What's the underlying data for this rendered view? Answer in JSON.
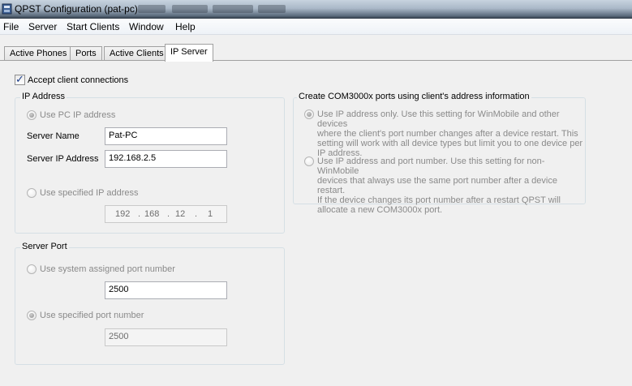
{
  "window": {
    "title": "QPST Configuration (pat-pc)"
  },
  "menu": [
    "File",
    "Server",
    "Start Clients",
    "Window",
    "Help"
  ],
  "tabs": [
    "Active Phones",
    "Ports",
    "Active Clients",
    "IP Server"
  ],
  "accept_connections": {
    "label": "Accept client connections",
    "checked": true
  },
  "ip_address": {
    "group_title": "IP Address",
    "use_pc_ip_label": "Use PC IP address",
    "server_name_label": "Server Name",
    "server_name_value": "Pat-PC",
    "server_ip_label": "Server IP Address",
    "server_ip_value": "192.168.2.5",
    "use_specified_ip_label": "Use specified IP address",
    "specified_ip": [
      "192",
      "168",
      "12",
      "1"
    ],
    "separator": "."
  },
  "server_port": {
    "group_title": "Server Port",
    "system_assigned_label": "Use system assigned port number",
    "system_port_value": "2500",
    "specified_label": "Use specified port number",
    "specified_port_value": "2500"
  },
  "com_ports": {
    "group_title": "Create COM3000x ports using client's address information",
    "option1_lines": [
      "Use IP address only. Use this setting for WinMobile and other devices",
      "where the client's port number changes after a device restart. This",
      "setting will work with all device types but limit you to one device per",
      "IP address."
    ],
    "option2_lines": [
      "Use IP address and port number. Use this setting for non-WinMobile",
      "devices that always use the same port number after a device restart.",
      "If the device changes its port number after a restart QPST will",
      "allocate a new COM3000x port."
    ]
  }
}
